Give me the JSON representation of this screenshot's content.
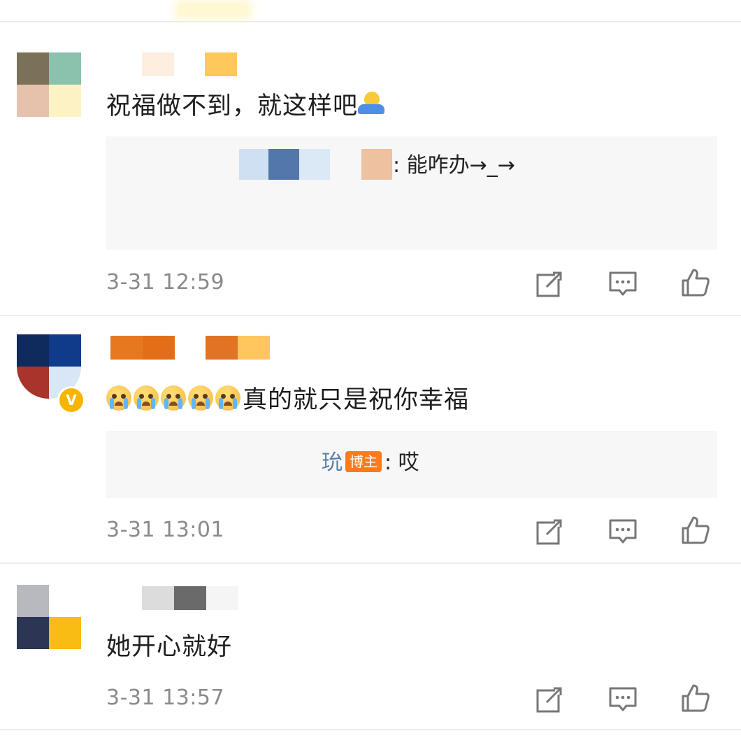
{
  "comments": [
    {
      "text": "祝福做不到，就这样吧",
      "emoji_suffix": "shrug-emoji",
      "reply": {
        "name": "",
        "tag": "",
        "text": ": 能咋办→_→"
      },
      "time": "3-31 12:59"
    },
    {
      "text": "真的就只是祝你幸福",
      "emoji_prefix": "crying-emoji",
      "emoji_count": 5,
      "verified": true,
      "reply": {
        "name": "玧",
        "tag": "博主",
        "text": ": 哎"
      },
      "time": "3-31 13:01"
    },
    {
      "text": "她开心就好",
      "reply": null,
      "time": "3-31 13:57"
    }
  ],
  "actions": {
    "share_icon": "share-icon",
    "comment_icon": "comment-icon",
    "like_icon": "thumbs-up-icon"
  },
  "colors": {
    "tag_bg": "#ff7a1a",
    "reply_name": "#5d7fa8",
    "timestamp": "#8a8a8a",
    "verified_badge": "#f7b500"
  }
}
